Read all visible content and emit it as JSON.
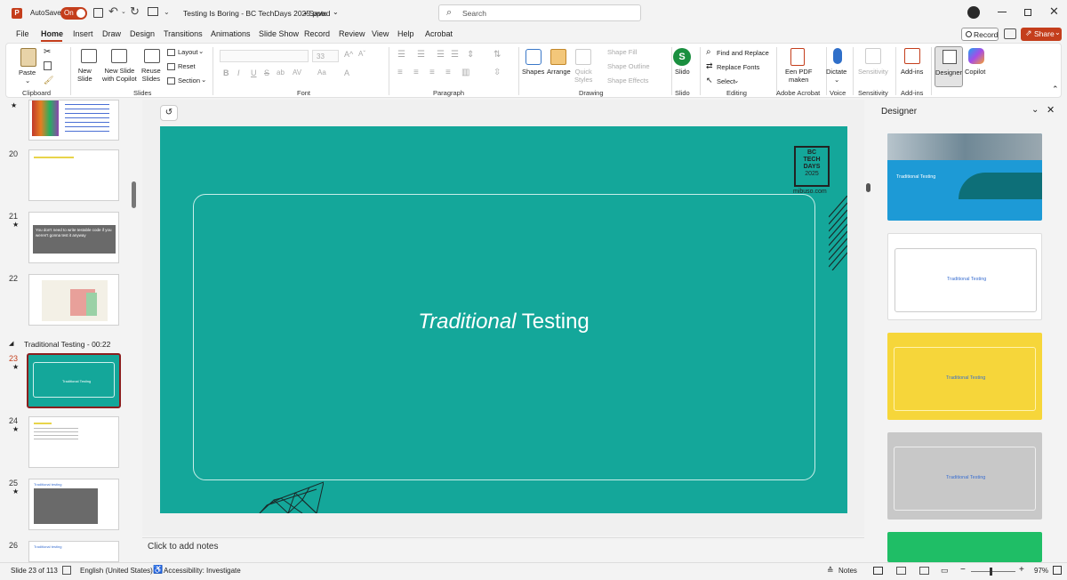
{
  "titlebar": {
    "autosave": "AutoSave",
    "autosave_state": "On",
    "doc_title": "Testing Is Boring - BC TechDays 2025.pptx",
    "saved": "• Saved",
    "search_placeholder": "Search"
  },
  "tabs": [
    "File",
    "Home",
    "Insert",
    "Draw",
    "Design",
    "Transitions",
    "Animations",
    "Slide Show",
    "Record",
    "Review",
    "View",
    "Help",
    "Acrobat"
  ],
  "tab_right": {
    "record": "Record",
    "share": "Share"
  },
  "ribbon": {
    "paste": "Paste",
    "new_slide": "New\nSlide",
    "new_slide_copilot": "New Slide\nwith Copilot",
    "reuse_slides": "Reuse\nSlides",
    "layout": "Layout",
    "reset": "Reset",
    "section": "Section",
    "font_size": "33",
    "shapes": "Shapes",
    "arrange": "Arrange",
    "quick_styles": "Quick\nStyles",
    "shape_fill": "Shape Fill",
    "shape_outline": "Shape Outline",
    "shape_effects": "Shape Effects",
    "slido": "Slido",
    "find_replace": "Find and Replace",
    "replace_fonts": "Replace Fonts",
    "select": "Select",
    "een_pdf": "Een PDF\nmaken",
    "dictate": "Dictate",
    "sensitivity": "Sensitivity",
    "addins": "Add-ins",
    "designer": "Designer",
    "copilot": "Copilot",
    "groups": {
      "clipboard": "Clipboard",
      "slides": "Slides",
      "font": "Font",
      "paragraph": "Paragraph",
      "drawing": "Drawing",
      "slido": "Slido",
      "editing": "Editing",
      "adobe": "Adobe Acrobat",
      "voice": "Voice",
      "sensitivity": "Sensitivity",
      "addins": "Add-ins"
    }
  },
  "thumbnails": {
    "nums": [
      "20",
      "21",
      "22",
      "23",
      "24",
      "25",
      "26"
    ],
    "section_header": "Traditional Testing - 00:22",
    "slide21_quote": "You don't need to write testable code if you weren't gonna test it anyway",
    "slide23_title": "Traditional Testing",
    "slide25_title": "Traditional testing",
    "slide26_title": "Traditional testing"
  },
  "slide": {
    "title_italic": "Traditional",
    "title_rest": " Testing",
    "logo": [
      "BC",
      "TECH",
      "DAYS",
      "2025"
    ],
    "logo_url": "mibuso.com"
  },
  "notes": {
    "placeholder": "Click to add notes"
  },
  "designer": {
    "title": "Designer",
    "card_title": "Traditional Testing",
    "card1_text": "Traditional Testing"
  },
  "status": {
    "slide": "Slide 23 of 113",
    "language": "English (United States)",
    "accessibility": "Accessibility: Investigate",
    "notes": "Notes",
    "zoom": "97%"
  },
  "colors": {
    "accent": "#c43e1c",
    "slide_bg": "#14a79a",
    "designer_yellow": "#f6d63a",
    "designer_gray": "#c8c8c8",
    "designer_green": "#1fbe66"
  }
}
